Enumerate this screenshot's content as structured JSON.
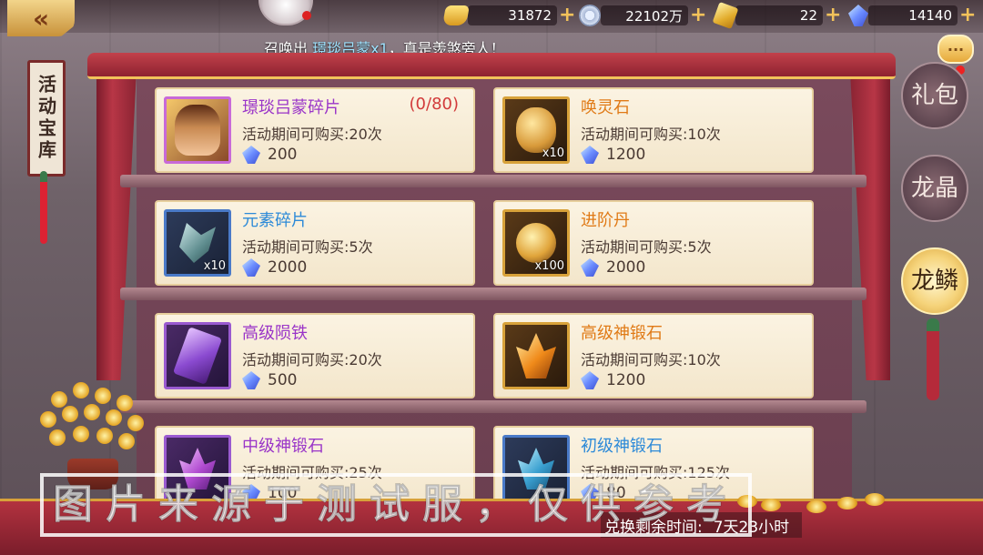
{
  "topbar": {
    "gold": "31872",
    "silver": "22102万",
    "ingot": "22",
    "crystal": "14140",
    "plus_label": "+"
  },
  "broadcast": {
    "prefix": "召唤出",
    "highlight": "璟琰吕蒙x1",
    "suffix": "，真是羡煞旁人！"
  },
  "side_banner": {
    "label": "活动宝库"
  },
  "items": [
    {
      "name": "璟琰吕蒙碎片",
      "progress": "(0/80)",
      "limit": "活动期间可购买:20次",
      "price": "200",
      "qty": "",
      "color": "purple"
    },
    {
      "name": "唤灵石",
      "progress": "",
      "limit": "活动期间可购买:10次",
      "price": "1200",
      "qty": "x10",
      "color": "orange"
    },
    {
      "name": "元素碎片",
      "progress": "",
      "limit": "活动期间可购买:5次",
      "price": "2000",
      "qty": "x10",
      "color": "blue"
    },
    {
      "name": "进阶丹",
      "progress": "",
      "limit": "活动期间可购买:5次",
      "price": "2000",
      "qty": "x100",
      "color": "orange"
    },
    {
      "name": "高级陨铁",
      "progress": "",
      "limit": "活动期间可购买:20次",
      "price": "500",
      "qty": "",
      "color": "purple"
    },
    {
      "name": "高级神锻石",
      "progress": "",
      "limit": "活动期间可购买:10次",
      "price": "1200",
      "qty": "",
      "color": "orange"
    },
    {
      "name": "中级神锻石",
      "progress": "",
      "limit": "活动期间可购买:25次",
      "price": "100",
      "qty": "",
      "color": "purple"
    },
    {
      "name": "初级神锻石",
      "progress": "",
      "limit": "活动期间可购买:125次",
      "price": "80",
      "qty": "",
      "color": "blue"
    }
  ],
  "side_tabs": [
    {
      "label": "礼包",
      "active": false
    },
    {
      "label": "龙晶",
      "active": false
    },
    {
      "label": "龙鳞",
      "active": true
    }
  ],
  "timer": {
    "label": "兑换剩余时间:",
    "value": "7天23小时"
  },
  "watermark": "图片来源于测试服，仅供参考",
  "colors": {
    "accent": "#d8a23a",
    "frame_red": "#b3323f",
    "name_orange": "#e07a16",
    "name_blue": "#2d8ad8",
    "name_purple": "#9a35c8",
    "progress_red": "#d23a3a"
  }
}
